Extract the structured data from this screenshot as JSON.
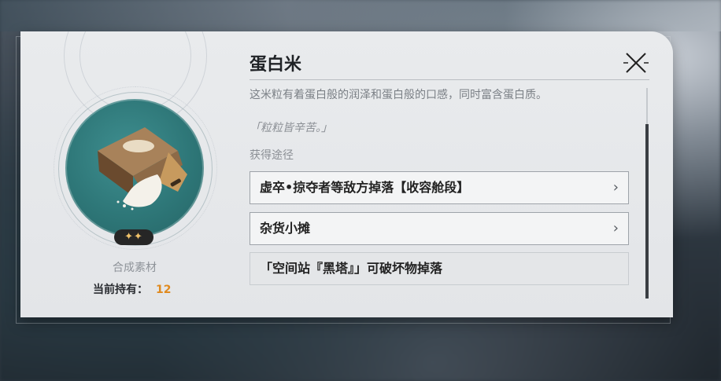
{
  "item": {
    "name": "蛋白米",
    "description": "这米粒有着蛋白般的润泽和蛋白般的口感，同时富含蛋白质。",
    "flavor_text": "「粒粒皆辛苦。」",
    "rarity_stars": "✦✦",
    "category": "合成素材",
    "owned_label": "当前持有：",
    "owned_count": "12"
  },
  "sources": {
    "label": "获得途径",
    "items": [
      {
        "text": "虚卒•掠夺者等敌方掉落【收容舱段】",
        "chevron": "›"
      },
      {
        "text": "杂货小摊",
        "chevron": "›"
      },
      {
        "text": "「空间站『黑塔』」可破坏物掉落"
      }
    ]
  },
  "icons": {
    "close": "close-icon",
    "item": "rice-bag-icon"
  },
  "colors": {
    "accent_orange": "#e08a1e",
    "circle_teal": "#2e7778"
  }
}
